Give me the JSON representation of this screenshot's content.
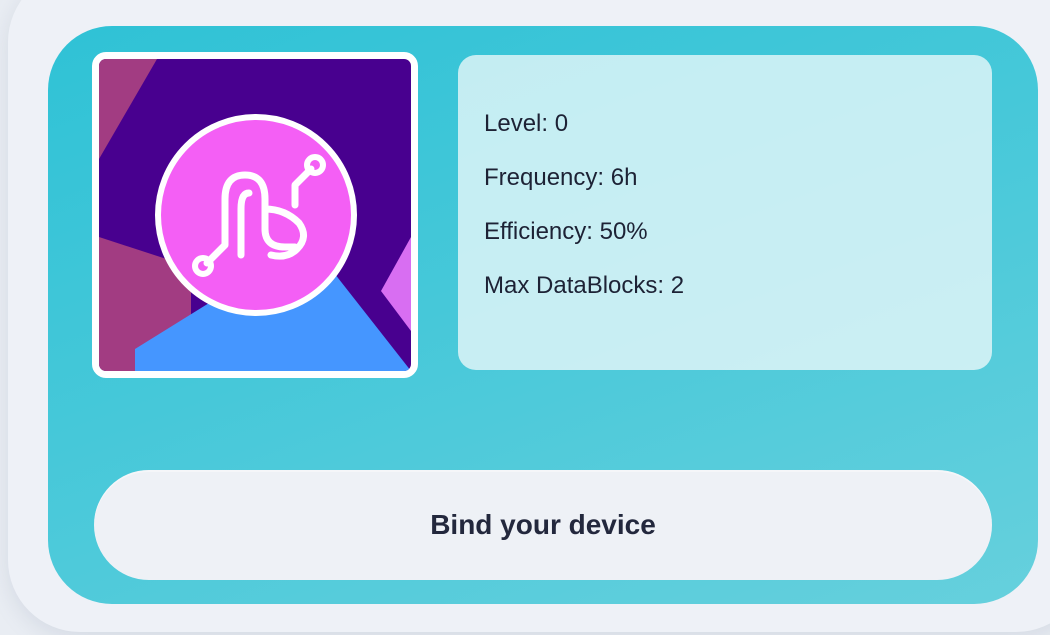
{
  "device_card": {
    "icon": "device-logo-icon",
    "stats": [
      "Level: 0",
      "Frequency: 6h",
      "Efficiency: 50%",
      "Max DataBlocks: 2"
    ],
    "bind_button_label": "Bind your device"
  },
  "colors": {
    "card_gradient_start": "#2fc2d6",
    "card_gradient_end": "#66d0dd",
    "logo_pink": "#f45ff5",
    "logo_background_purple": "#47008e",
    "logo_background_blue": "#4596ff",
    "button_background": "#eef1f6"
  }
}
